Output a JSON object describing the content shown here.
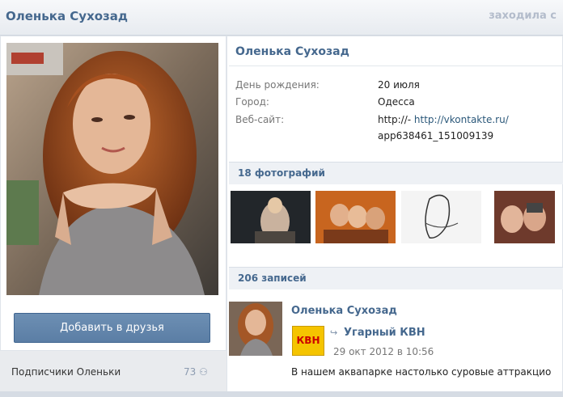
{
  "header": {
    "name": "Оленька Сухозад",
    "status": "заходила с"
  },
  "profile": {
    "name": "Оленька Сухозад",
    "add_friend_button": "Добавить в друзья",
    "subscribers_label": "Подписчики Оленьки",
    "subscribers_count": "73"
  },
  "info": [
    {
      "label": "День рождения:",
      "value": "20 июля"
    },
    {
      "label": "Город:",
      "value": "Одесса"
    },
    {
      "label": "Веб-сайт:",
      "value_prefix": "http://- ",
      "value_link": "http://vkontakte.ru/",
      "value_line2": "app638461_151009139"
    }
  ],
  "photos": {
    "title": "18 фотографий"
  },
  "wall": {
    "title": "206 записей",
    "post": {
      "author": "Оленька Сухозад",
      "group": "Угарный КВН",
      "group_logo_text": "КВН",
      "time": "29 окт 2012 в 10:56",
      "text": "В нашем аквапарке настолько суровые аттракцио"
    }
  }
}
